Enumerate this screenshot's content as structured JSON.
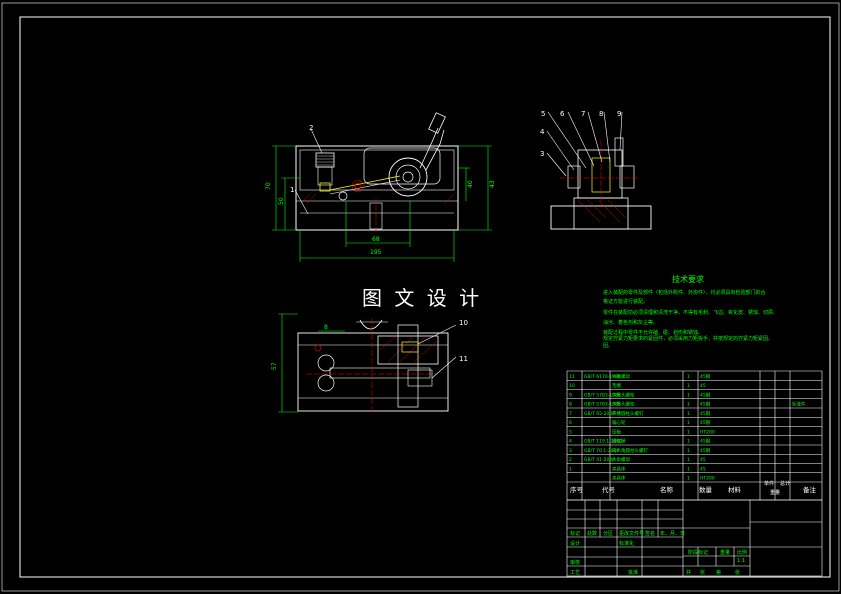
{
  "watermark": "图 文 设 计",
  "balloons": [
    "1",
    "2",
    "3",
    "4",
    "5",
    "6",
    "7",
    "8",
    "9",
    "10",
    "11"
  ],
  "dimensions": {
    "width_overall": "195",
    "width_inner": "68",
    "h1": "70",
    "h2": "50",
    "h3": "40",
    "h4": "43",
    "h5": "57",
    "slot": "8"
  },
  "tech": {
    "title": "技术要求",
    "lines": [
      "进入装配的零件及部件（包括外购件、外协件），均必须具有检验部门的合",
      "格证方能进行装配。",
      "零件在装配前必须清理和清洗干净，不得有毛刺、飞边、氧化皮、锈蚀、切屑、",
      "油污、着色剂和灰尘等。",
      "装配过程中零件不允许磕、碰、划伤和锈蚀。",
      "规定拧紧力矩要求的紧固件，必须采用力矩扳手，并按规定的拧紧力矩紧固。",
      "固。"
    ]
  },
  "bom": {
    "rows": [
      {
        "no": "11",
        "code": "GB/T 6170-1986",
        "name": "六角螺母",
        "qty": "1",
        "mat": "45钢",
        "note": ""
      },
      {
        "no": "10",
        "code": "",
        "name": "垫圈",
        "qty": "1",
        "mat": "45",
        "note": ""
      },
      {
        "no": "9",
        "code": "GB/T 5783-1986",
        "name": "六角头螺栓",
        "qty": "1",
        "mat": "45钢",
        "note": ""
      },
      {
        "no": "8",
        "code": "GB/T 5783-1986",
        "name": "六角头螺栓",
        "qty": "1",
        "mat": "45钢",
        "note": "标准件"
      },
      {
        "no": "7",
        "code": "GB/T 65-2000",
        "name": "开槽圆柱头螺钉",
        "qty": "1",
        "mat": "45钢",
        "note": ""
      },
      {
        "no": "6",
        "code": "",
        "name": "偏心轮",
        "qty": "1",
        "mat": "45钢",
        "note": ""
      },
      {
        "no": "5",
        "code": "",
        "name": "压板",
        "qty": "1",
        "mat": "HT200",
        "note": ""
      },
      {
        "no": "4",
        "code": "GB/T 119.1-2000",
        "name": "圆柱销",
        "qty": "1",
        "mat": "45钢",
        "note": ""
      },
      {
        "no": "3",
        "code": "GB/T 70.1-2000",
        "name": "内六角圆柱头螺钉",
        "qty": "1",
        "mat": "45钢",
        "note": ""
      },
      {
        "no": "2",
        "code": "GB/T 41-2000",
        "name": "六角螺母",
        "qty": "1",
        "mat": "45",
        "note": ""
      },
      {
        "no": "1",
        "code": "",
        "name": "夹具体",
        "qty": "1",
        "mat": "45",
        "note": ""
      },
      {
        "no": "",
        "code": "",
        "name": "夹具体",
        "qty": "1",
        "mat": "HT200",
        "note": ""
      }
    ],
    "header": {
      "no": "序号",
      "code": "代号",
      "name": "名称",
      "qty": "数量",
      "mat": "材料",
      "unit": "单件",
      "total": "总计",
      "weight": "重量",
      "note": "备注"
    }
  },
  "titleblock": {
    "row1": [
      "标记",
      "处数",
      "分区",
      "更改文件号",
      "签名",
      "年、月、日"
    ],
    "design": "设计",
    "std": "标准化",
    "stage": "阶段标记",
    "weight": "重量",
    "scale": "比例",
    "scale_val": "1:1",
    "review": "审核",
    "craft": "工艺",
    "approve": "批准",
    "sheets": [
      "共",
      "张",
      "第",
      "张"
    ]
  }
}
